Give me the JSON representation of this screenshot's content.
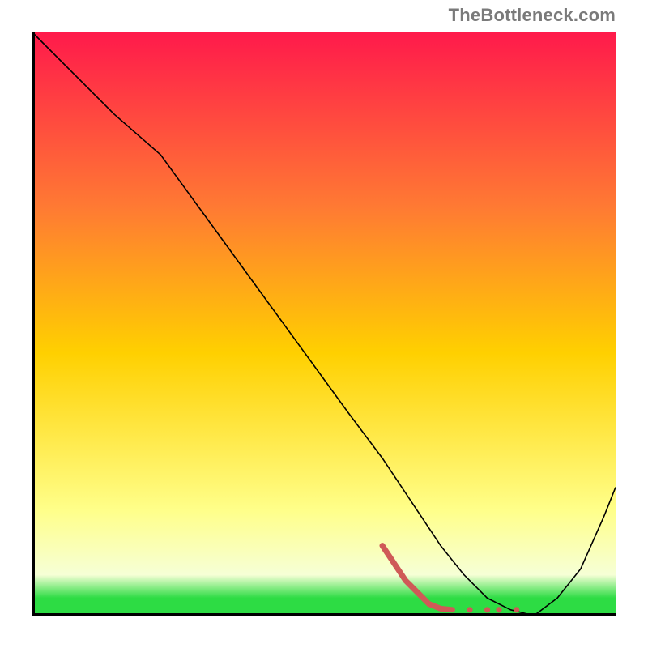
{
  "watermark": "TheBottleneck.com",
  "chart_data": {
    "type": "line",
    "title": "",
    "xlabel": "",
    "ylabel": "",
    "xlim": [
      0,
      100
    ],
    "ylim": [
      0,
      100
    ],
    "gradient_top": "#ff1a4b",
    "gradient_mid_upper": "#ff7a33",
    "gradient_mid": "#ffd000",
    "gradient_lower": "#ffff8a",
    "gradient_pale": "#f6ffd6",
    "gradient_green": "#2ddc44",
    "series": [
      {
        "name": "curve",
        "color": "#000000",
        "stroke_width": 1.6,
        "x": [
          0,
          7,
          14,
          22,
          30,
          38,
          46,
          54,
          60,
          66,
          70,
          74,
          78,
          82,
          86,
          90,
          94,
          98,
          100
        ],
        "y": [
          100,
          93,
          86,
          79,
          68,
          57,
          46,
          35,
          27,
          18,
          12,
          7,
          3,
          1,
          0,
          3,
          8,
          17,
          22
        ]
      },
      {
        "name": "highlight",
        "color": "#cf5a57",
        "stroke_width": 7,
        "cap": "round",
        "x": [
          60,
          64,
          68,
          70,
          72
        ],
        "y": [
          12,
          6,
          2,
          1.2,
          1
        ]
      },
      {
        "name": "highlight-dots",
        "color": "#cf5a57",
        "type": "scatter",
        "r": 3.6,
        "x": [
          75,
          78,
          80,
          83
        ],
        "y": [
          1,
          1,
          1,
          1
        ]
      }
    ]
  }
}
